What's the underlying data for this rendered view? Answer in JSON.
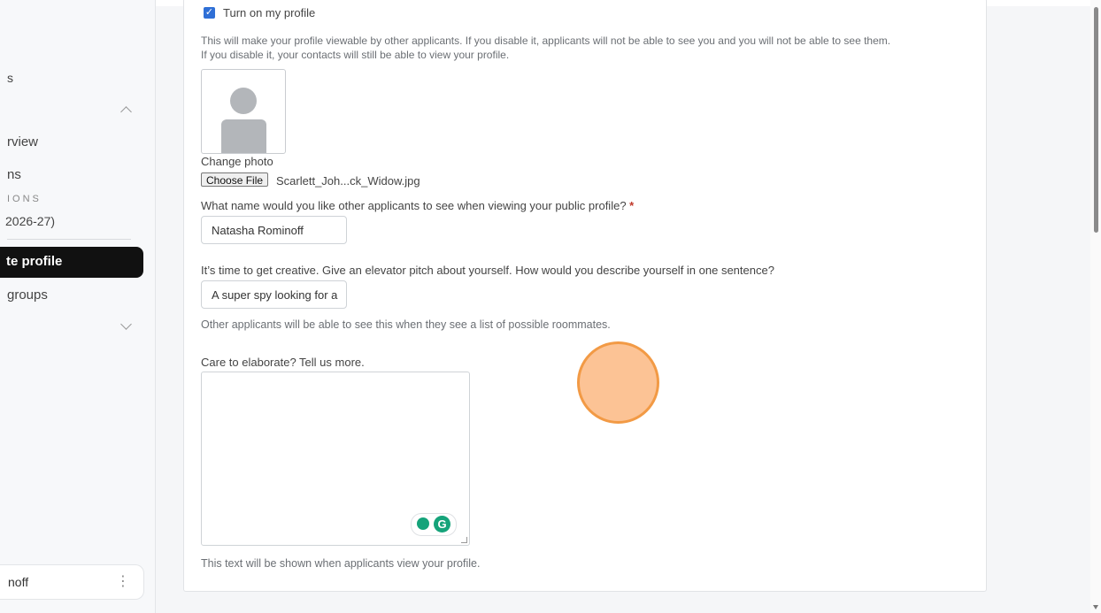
{
  "sidebar": {
    "item_s": "s",
    "item_overview": "rview",
    "item_ns": "ns",
    "section_label": "IONS",
    "item_year": "2026-27)",
    "active_item": "te profile",
    "item_groups": "groups",
    "user_name": "noff",
    "user_menu": "⋮"
  },
  "profile": {
    "toggle_label": "Turn on my profile",
    "toggle_checked": true,
    "toggle_help_1": "This will make your profile viewable by other applicants. If you disable it, applicants will not be able to see you and you will not be able to see them.",
    "toggle_help_2": "If you disable it, your contacts will still be able to view your profile.",
    "change_photo_label": "Change photo",
    "choose_file_button": "Choose File",
    "chosen_file_name": "Scarlett_Joh...ck_Widow.jpg",
    "name_question": "What name would you like other applicants to see when viewing your public profile?",
    "required_mark": "*",
    "name_value": "Natasha Rominoff",
    "pitch_question": "It’s time to get creative. Give an elevator pitch about yourself. How would you describe yourself in one sentence?",
    "pitch_value": "A super spy looking for a",
    "pitch_help": "Other applicants will be able to see this when they see a list of possible roommates.",
    "elaborate_question": "Care to elaborate? Tell us more.",
    "elaborate_value": "",
    "elaborate_help": "This text will be shown when applicants view your profile.",
    "grammarly_letter": "G"
  },
  "colors": {
    "accent": "#2f6fd6",
    "active_nav": "#111111",
    "required": "#c0392b",
    "click_indicator": "#f29a45",
    "grammarly": "#15a37a"
  }
}
